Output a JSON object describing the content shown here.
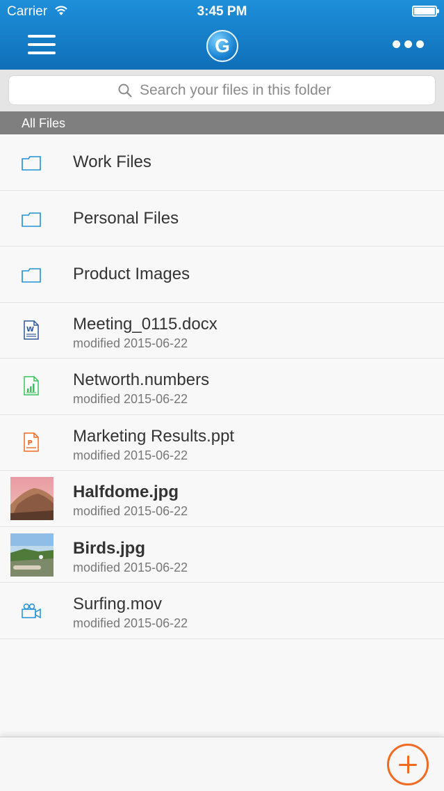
{
  "status_bar": {
    "carrier": "Carrier",
    "time": "3:45 PM"
  },
  "header": {
    "logo_letter": "G",
    "menu_icon": "hamburger-icon",
    "more_icon": "ellipsis-icon"
  },
  "search": {
    "placeholder": "Search your files in this folder"
  },
  "section": {
    "title": "All Files"
  },
  "files": [
    {
      "name": "Work Files",
      "icon": "folder-icon"
    },
    {
      "name": "Personal Files",
      "icon": "folder-icon"
    },
    {
      "name": "Product Images",
      "icon": "folder-icon"
    },
    {
      "name": "Meeting_0115.docx",
      "modified": "modified 2015-06-22",
      "icon": "word-document-icon"
    },
    {
      "name": "Networth.numbers",
      "modified": "modified 2015-06-22",
      "icon": "spreadsheet-icon"
    },
    {
      "name": "Marketing Results.ppt",
      "modified": "modified 2015-06-22",
      "icon": "powerpoint-icon"
    },
    {
      "name": "Halfdome.jpg",
      "modified": "modified 2015-06-22",
      "icon": "image-thumbnail"
    },
    {
      "name": "Birds.jpg",
      "modified": "modified 2015-06-22",
      "icon": "image-thumbnail"
    },
    {
      "name": "Surfing.mov",
      "modified": "modified 2015-06-22",
      "icon": "video-camera-icon"
    }
  ],
  "colors": {
    "header_blue": "#1a85d0",
    "folder_blue": "#1f8fd6",
    "word_blue": "#2a5699",
    "numbers_green": "#35c45a",
    "ppt_orange": "#f06a22",
    "add_orange": "#f06a22"
  }
}
